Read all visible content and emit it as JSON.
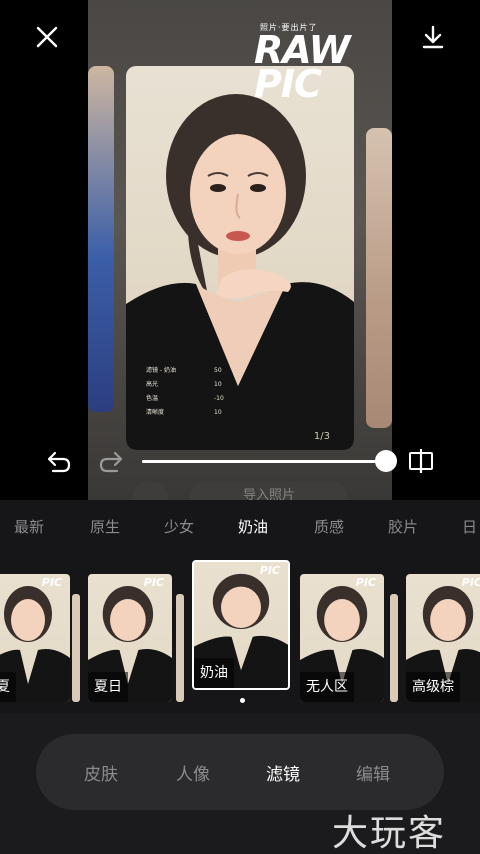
{
  "preview": {
    "brand_tag": "照片·要出片了",
    "brand_line1": "RAW",
    "brand_line2": "PIC",
    "info_rows": [
      {
        "label": "滤镜 - 奶油",
        "value": "50"
      },
      {
        "label": "高光",
        "value": "10"
      },
      {
        "label": "色温",
        "value": "-10"
      },
      {
        "label": "清晰度",
        "value": "10"
      }
    ],
    "page_indicator": "1/3",
    "slider_value": 1.0,
    "import_label": "导入照片"
  },
  "toolbar": {
    "close_icon": "close-icon",
    "download_icon": "download-icon",
    "undo_icon": "undo-icon",
    "redo_icon": "redo-icon",
    "compare_icon": "compare-icon"
  },
  "categories": [
    "最新",
    "原生",
    "少女",
    "奶油",
    "质感",
    "胶片",
    "日"
  ],
  "active_category": "奶油",
  "filters": {
    "items": [
      "夏",
      "夏日",
      "奶油",
      "无人区",
      "高级棕"
    ],
    "thumb_brand": "PIC",
    "selected": "奶油"
  },
  "bottom_nav": {
    "items": [
      "皮肤",
      "人像",
      "滤镜",
      "编辑"
    ],
    "active": "滤镜"
  },
  "watermark": "大玩客",
  "colors": {
    "background": "#1b1b1d",
    "active_text": "#ffffff",
    "inactive_text": "#8b8b8d",
    "nav_pill": "#2b2b2d"
  }
}
